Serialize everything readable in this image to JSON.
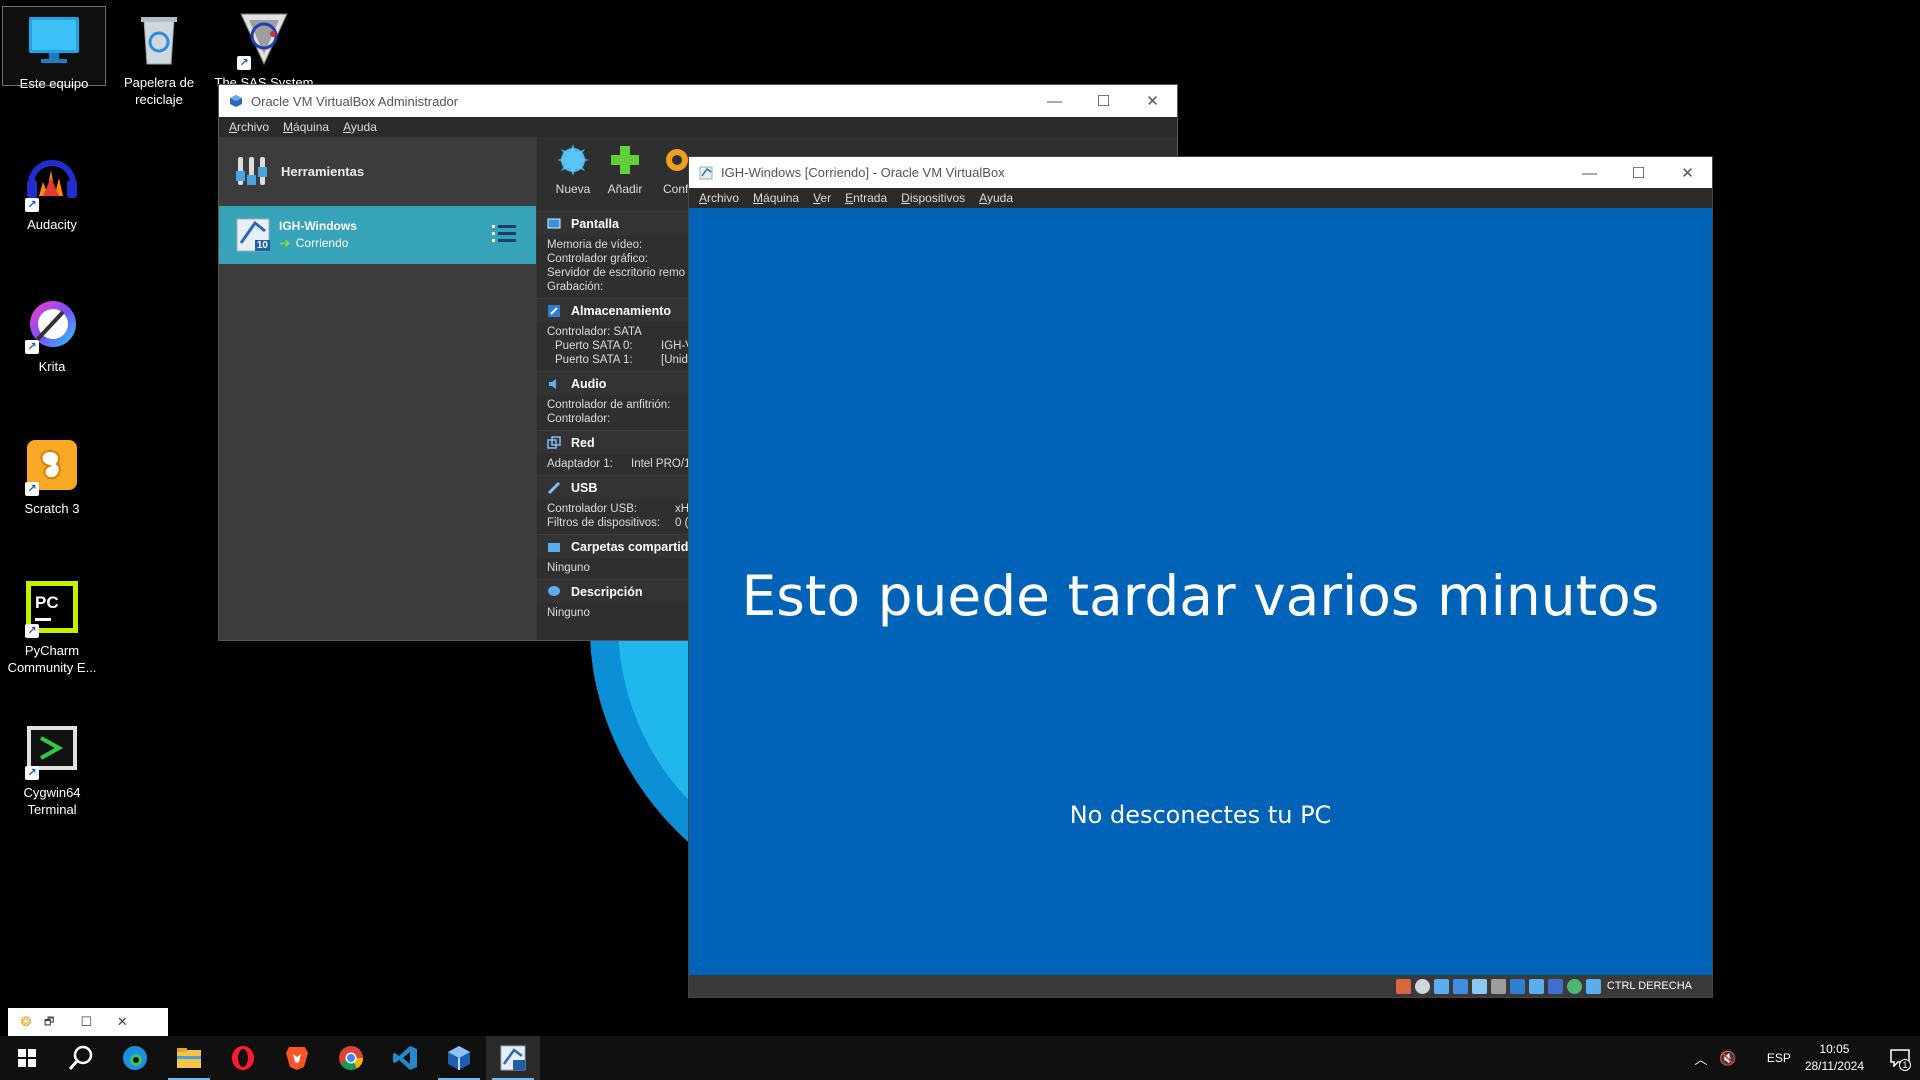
{
  "desktop": {
    "icons": [
      {
        "label": "Este equipo",
        "icon": "monitor-icon"
      },
      {
        "label": "Papelera de reciclaje",
        "icon": "recycle-bin-icon"
      },
      {
        "label": "The SAS System",
        "icon": "sas-icon"
      },
      {
        "label": "Audacity",
        "icon": "audacity-icon"
      },
      {
        "label": "Krita",
        "icon": "krita-icon"
      },
      {
        "label": "Scratch 3",
        "icon": "scratch-icon"
      },
      {
        "label": "PyCharm Community E...",
        "icon": "pycharm-icon"
      },
      {
        "label": "Cygwin64 Terminal",
        "icon": "cygwin-icon"
      }
    ]
  },
  "manager": {
    "title": "Oracle VM VirtualBox Administrador",
    "menu": [
      "Archivo",
      "Máquina",
      "Ayuda"
    ],
    "tools_label": "Herramientas",
    "vm": {
      "name": "IGH-Windows",
      "state": "Corriendo",
      "badge": "10"
    },
    "toolbar": [
      "Nueva",
      "Añadir",
      "Confi"
    ],
    "sections": {
      "display": {
        "title": "Pantalla",
        "lines": [
          "Memoria de vídeo:",
          "Controlador gráfico:",
          "Servidor de escritorio remo",
          "Grabación:"
        ]
      },
      "storage": {
        "title": "Almacenamiento",
        "controller": "Controlador: SATA",
        "port0_k": "Puerto SATA 0:",
        "port0_v": "IGH-V",
        "port1_k": "Puerto SATA 1:",
        "port1_v": "[Unid"
      },
      "audio": {
        "title": "Audio",
        "lines": [
          "Controlador de anfitrión:",
          "Controlador:"
        ]
      },
      "network": {
        "title": "Red",
        "adapter_k": "Adaptador 1:",
        "adapter_v": "Intel PRO/1"
      },
      "usb": {
        "title": "USB",
        "ctrl_k": "Controlador USB:",
        "ctrl_v": "xH",
        "filters_k": "Filtros de dispositivos:",
        "filters_v": "0 ("
      },
      "shared": {
        "title": "Carpetas compartid",
        "value": "Ninguno"
      },
      "description": {
        "title": "Descripción",
        "value": "Ninguno"
      }
    }
  },
  "vmwindow": {
    "title": "IGH-Windows [Corriendo] - Oracle VM VirtualBox",
    "menu": [
      "Archivo",
      "Máquina",
      "Ver",
      "Entrada",
      "Dispositivos",
      "Ayuda"
    ],
    "message_main": "Esto puede tardar varios minutos",
    "message_sub": "No desconectes tu PC",
    "host_key": "CTRL DERECHA"
  },
  "taskbar": {
    "items": [
      "windows-start-icon",
      "search-icon",
      "edge-icon",
      "file-explorer-icon",
      "opera-icon",
      "brave-icon",
      "chrome-icon",
      "vscode-icon",
      "virtualbox-icon",
      "virtualbox-vm-icon"
    ],
    "language": "ESP",
    "time": "10:05",
    "date": "28/11/2024",
    "notifications": "1"
  },
  "colors": {
    "accent_vm_row": "#36a3b8",
    "guest_bg": "#0163b8"
  }
}
